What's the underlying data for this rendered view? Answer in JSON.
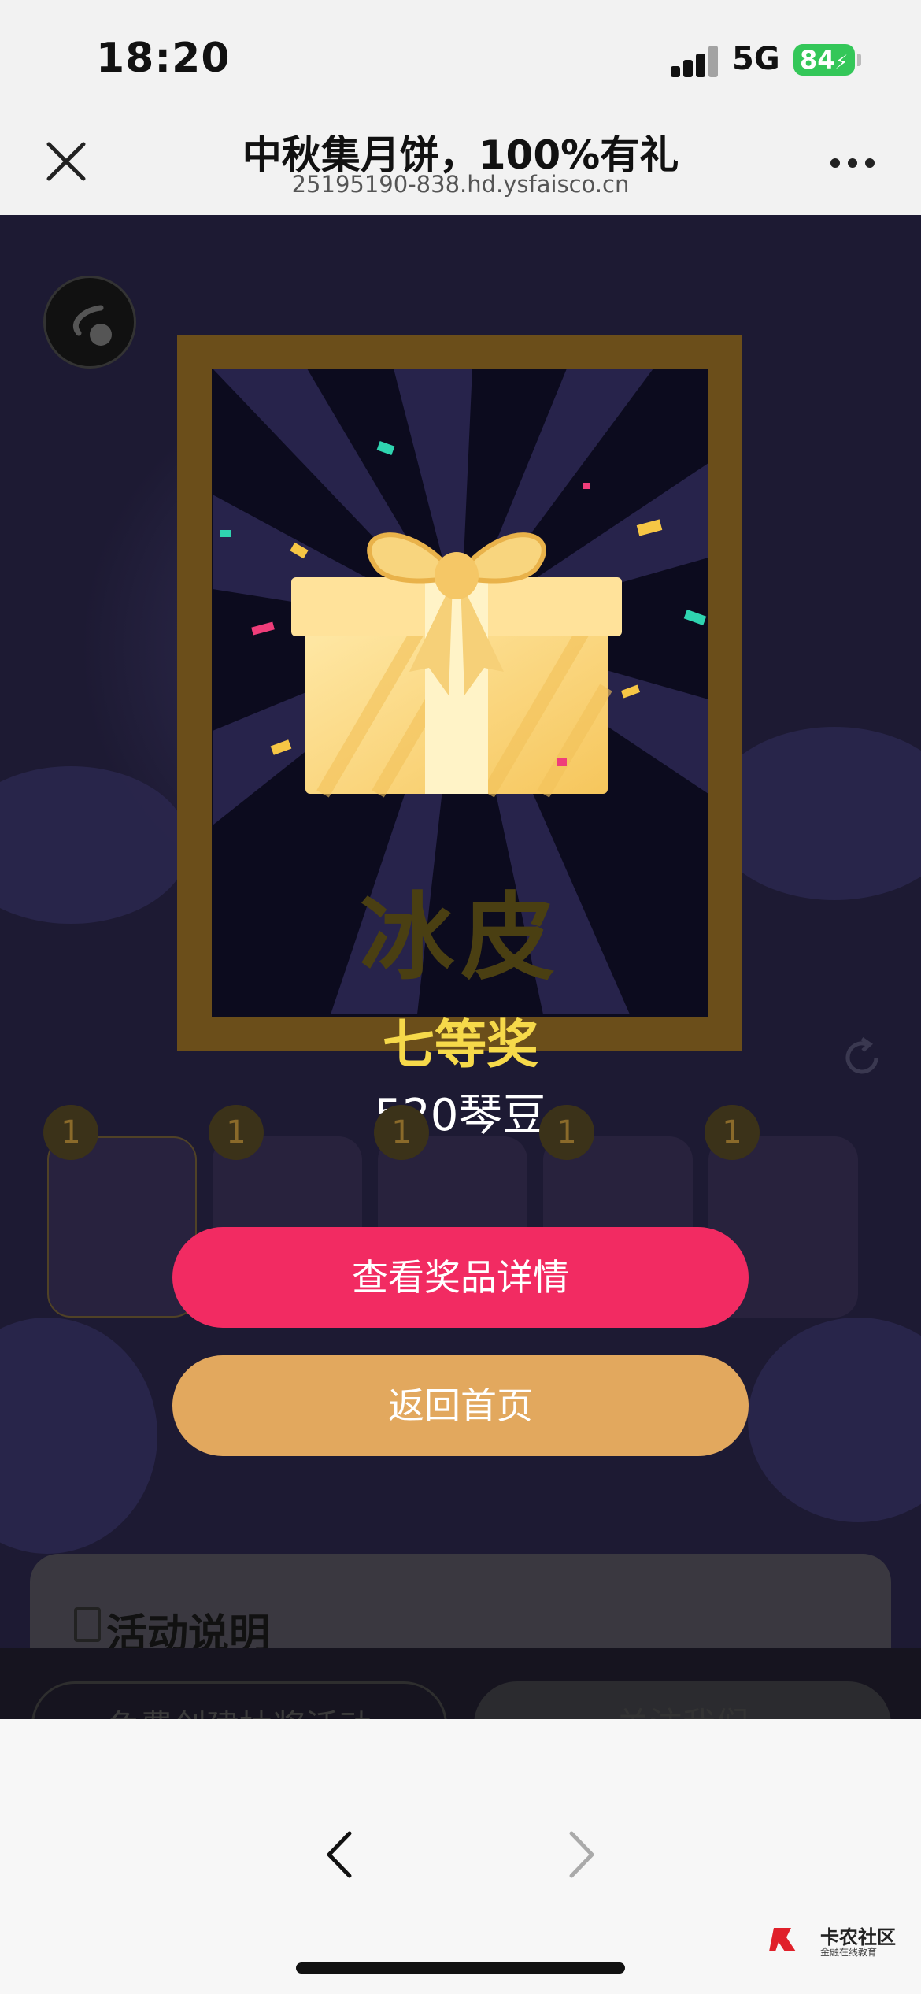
{
  "status_bar": {
    "time": "18:20",
    "network": "5G",
    "battery": "84"
  },
  "nav": {
    "title": "中秋集月饼，100%有礼",
    "url": "25195190-838.hd.ysfaisco.cn"
  },
  "game": {
    "mooncake_label": "冰皮",
    "slot_counts": [
      "1",
      "1",
      "1",
      "1",
      "1"
    ]
  },
  "prize": {
    "level": "七等奖",
    "name": "520琴豆"
  },
  "buttons": {
    "view_detail": "查看奖品详情",
    "back_home": "返回首页"
  },
  "activity": {
    "title": "活动说明"
  },
  "footer": {
    "create_label": "免费创建抽奖活动",
    "follow_label": "关注我们"
  },
  "watermark": {
    "name": "卡农社区",
    "tagline": "金融在线教育"
  },
  "colors": {
    "prize_yellow": "#f6d94a",
    "detail_button": "#f22b62",
    "home_button": "#e2a85e"
  }
}
